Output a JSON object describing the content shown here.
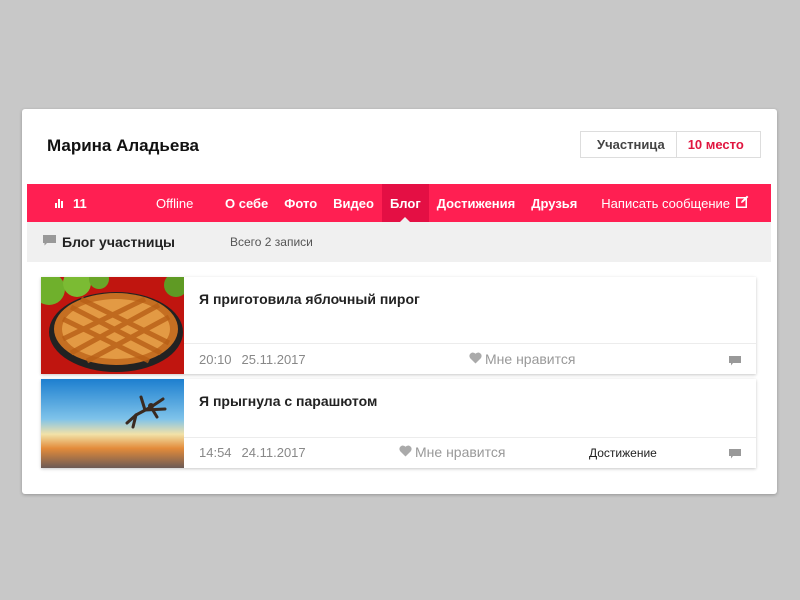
{
  "profile": {
    "name": "Марина Аладьева"
  },
  "rank": {
    "role": "Участница",
    "place": "10 место"
  },
  "nav": {
    "stat_icon": "bar-chart-icon",
    "stat_value": "11",
    "status": "Offline",
    "tabs": [
      {
        "label": "О себе",
        "active": false
      },
      {
        "label": "Фото",
        "active": false
      },
      {
        "label": "Видео",
        "active": false
      },
      {
        "label": "Блог",
        "active": true
      },
      {
        "label": "Достижения",
        "active": false
      },
      {
        "label": "Друзья",
        "active": false
      }
    ],
    "message_label": "Написать сообщение",
    "message_icon": "edit-icon"
  },
  "blog": {
    "icon": "comment-icon",
    "title": "Блог участницы",
    "count": "Всего 2 записи"
  },
  "posts": [
    {
      "title": "Я приготовила яблочный пирог",
      "time": "20:10",
      "date": "25.11.2017",
      "like_label": "Мне нравится",
      "achievement": "",
      "thumb": "apple-pie-photo"
    },
    {
      "title": "Я прыгнула с парашютом",
      "time": "14:54",
      "date": "24.11.2017",
      "like_label": "Мне нравится",
      "achievement": "Достижение",
      "thumb": "skydiver-photo"
    }
  ],
  "colors": {
    "accent": "#ff1f52",
    "accent_dark": "#e40f44",
    "place": "#e0153f"
  }
}
